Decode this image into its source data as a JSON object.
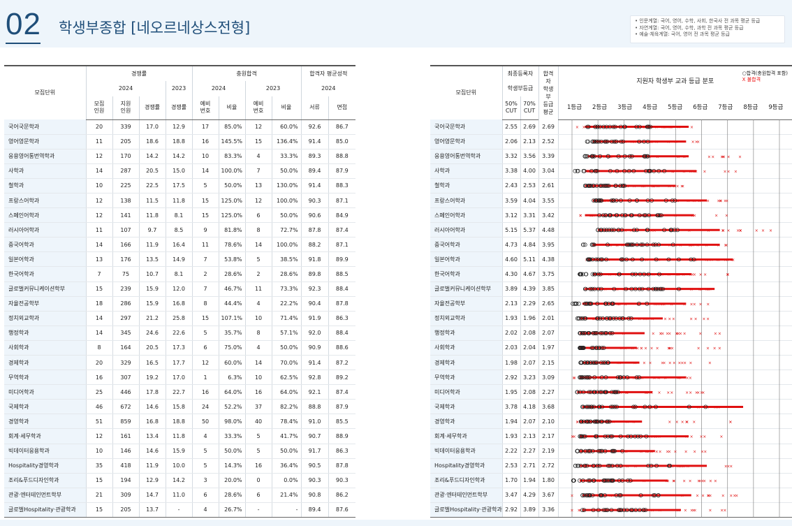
{
  "header": {
    "section_number": "02",
    "section_title": "학생부종합 [네오르네상스전형]",
    "notes": [
      "• 인문계열: 국어, 영어, 수학, 사회, 한국사 전 과목 평균 등급",
      "• 자연계열: 국어, 영어, 수학, 과학 전 과목 평균 등급",
      "• 예술·체육계열: 국어, 영어 전 과목 평균 등급"
    ]
  },
  "left_table": {
    "headers": {
      "unit": "모집단위",
      "competition": "경쟁률",
      "additional": "충원합격",
      "avg_score": "합격자 평균성적",
      "year_2024": "2024",
      "year_2023": "2023",
      "recruit": "모집\n인원",
      "applicants": "지원\n인원",
      "comp_rate": "경쟁률",
      "comp_rate_2023": "경쟁률",
      "waitlist_2024": "예비\n번호",
      "ratio_2024": "비율",
      "waitlist_2023": "예비\n번호",
      "ratio_2023": "비율",
      "documents": "서류",
      "interview": "면접"
    },
    "rows": [
      {
        "name": "국어국문학과",
        "recruit": "20",
        "applicants": "339",
        "comp": "17.0",
        "comp23": "12.9",
        "wait24": "17",
        "ratio24": "85.0%",
        "wait23": "12",
        "ratio23": "60.0%",
        "doc": "92.6",
        "intv": "86.7"
      },
      {
        "name": "영어영문학과",
        "recruit": "11",
        "applicants": "205",
        "comp": "18.6",
        "comp23": "18.8",
        "wait24": "16",
        "ratio24": "145.5%",
        "wait23": "15",
        "ratio23": "136.4%",
        "doc": "91.4",
        "intv": "85.0"
      },
      {
        "name": "응용영어통번역학과",
        "recruit": "12",
        "applicants": "170",
        "comp": "14.2",
        "comp23": "14.2",
        "wait24": "10",
        "ratio24": "83.3%",
        "wait23": "4",
        "ratio23": "33.3%",
        "doc": "89.3",
        "intv": "88.8"
      },
      {
        "name": "사학과",
        "recruit": "14",
        "applicants": "287",
        "comp": "20.5",
        "comp23": "15.0",
        "wait24": "14",
        "ratio24": "100.0%",
        "wait23": "7",
        "ratio23": "50.0%",
        "doc": "89.4",
        "intv": "87.9"
      },
      {
        "name": "철학과",
        "recruit": "10",
        "applicants": "225",
        "comp": "22.5",
        "comp23": "17.5",
        "wait24": "5",
        "ratio24": "50.0%",
        "wait23": "13",
        "ratio23": "130.0%",
        "doc": "91.4",
        "intv": "88.3"
      },
      {
        "name": "프랑스어학과",
        "recruit": "12",
        "applicants": "138",
        "comp": "11.5",
        "comp23": "11.8",
        "wait24": "15",
        "ratio24": "125.0%",
        "wait23": "12",
        "ratio23": "100.0%",
        "doc": "90.3",
        "intv": "87.1"
      },
      {
        "name": "스페인어학과",
        "recruit": "12",
        "applicants": "141",
        "comp": "11.8",
        "comp23": "8.1",
        "wait24": "15",
        "ratio24": "125.0%",
        "wait23": "6",
        "ratio23": "50.0%",
        "doc": "90.6",
        "intv": "84.9"
      },
      {
        "name": "러시아어학과",
        "recruit": "11",
        "applicants": "107",
        "comp": "9.7",
        "comp23": "8.5",
        "wait24": "9",
        "ratio24": "81.8%",
        "wait23": "8",
        "ratio23": "72.7%",
        "doc": "87.8",
        "intv": "87.4"
      },
      {
        "name": "중국어학과",
        "recruit": "14",
        "applicants": "166",
        "comp": "11.9",
        "comp23": "16.4",
        "wait24": "11",
        "ratio24": "78.6%",
        "wait23": "14",
        "ratio23": "100.0%",
        "doc": "88.2",
        "intv": "87.1"
      },
      {
        "name": "일본어학과",
        "recruit": "13",
        "applicants": "176",
        "comp": "13.5",
        "comp23": "14.9",
        "wait24": "7",
        "ratio24": "53.8%",
        "wait23": "5",
        "ratio23": "38.5%",
        "doc": "91.8",
        "intv": "89.9"
      },
      {
        "name": "한국어학과",
        "recruit": "7",
        "applicants": "75",
        "comp": "10.7",
        "comp23": "8.1",
        "wait24": "2",
        "ratio24": "28.6%",
        "wait23": "2",
        "ratio23": "28.6%",
        "doc": "89.8",
        "intv": "88.5"
      },
      {
        "name": "글로벌커뮤니케이션학부",
        "recruit": "15",
        "applicants": "239",
        "comp": "15.9",
        "comp23": "12.0",
        "wait24": "7",
        "ratio24": "46.7%",
        "wait23": "11",
        "ratio23": "73.3%",
        "doc": "92.3",
        "intv": "88.4"
      },
      {
        "name": "자율전공학부",
        "recruit": "18",
        "applicants": "286",
        "comp": "15.9",
        "comp23": "16.8",
        "wait24": "8",
        "ratio24": "44.4%",
        "wait23": "4",
        "ratio23": "22.2%",
        "doc": "90.4",
        "intv": "87.8"
      },
      {
        "name": "정치외교학과",
        "recruit": "14",
        "applicants": "297",
        "comp": "21.2",
        "comp23": "25.8",
        "wait24": "15",
        "ratio24": "107.1%",
        "wait23": "10",
        "ratio23": "71.4%",
        "doc": "91.9",
        "intv": "86.3"
      },
      {
        "name": "행정학과",
        "recruit": "14",
        "applicants": "345",
        "comp": "24.6",
        "comp23": "22.6",
        "wait24": "5",
        "ratio24": "35.7%",
        "wait23": "8",
        "ratio23": "57.1%",
        "doc": "92.0",
        "intv": "88.4"
      },
      {
        "name": "사회학과",
        "recruit": "8",
        "applicants": "164",
        "comp": "20.5",
        "comp23": "17.3",
        "wait24": "6",
        "ratio24": "75.0%",
        "wait23": "4",
        "ratio23": "50.0%",
        "doc": "90.9",
        "intv": "88.6"
      },
      {
        "name": "경제학과",
        "recruit": "20",
        "applicants": "329",
        "comp": "16.5",
        "comp23": "17.7",
        "wait24": "12",
        "ratio24": "60.0%",
        "wait23": "14",
        "ratio23": "70.0%",
        "doc": "91.4",
        "intv": "87.2"
      },
      {
        "name": "무역학과",
        "recruit": "16",
        "applicants": "307",
        "comp": "19.2",
        "comp23": "17.0",
        "wait24": "1",
        "ratio24": "6.3%",
        "wait23": "10",
        "ratio23": "62.5%",
        "doc": "92.8",
        "intv": "89.2"
      },
      {
        "name": "미디어학과",
        "recruit": "25",
        "applicants": "446",
        "comp": "17.8",
        "comp23": "22.7",
        "wait24": "16",
        "ratio24": "64.0%",
        "wait23": "16",
        "ratio23": "64.0%",
        "doc": "92.1",
        "intv": "87.4"
      },
      {
        "name": "국제학과",
        "recruit": "46",
        "applicants": "672",
        "comp": "14.6",
        "comp23": "15.8",
        "wait24": "24",
        "ratio24": "52.2%",
        "wait23": "37",
        "ratio23": "82.2%",
        "doc": "88.8",
        "intv": "87.9"
      },
      {
        "name": "경영학과",
        "recruit": "51",
        "applicants": "859",
        "comp": "16.8",
        "comp23": "18.8",
        "wait24": "50",
        "ratio24": "98.0%",
        "wait23": "40",
        "ratio23": "78.4%",
        "doc": "91.0",
        "intv": "85.5"
      },
      {
        "name": "회계·세무학과",
        "recruit": "12",
        "applicants": "161",
        "comp": "13.4",
        "comp23": "11.8",
        "wait24": "4",
        "ratio24": "33.3%",
        "wait23": "5",
        "ratio23": "41.7%",
        "doc": "90.7",
        "intv": "88.9"
      },
      {
        "name": "빅데이터응용학과",
        "recruit": "10",
        "applicants": "146",
        "comp": "14.6",
        "comp23": "15.9",
        "wait24": "5",
        "ratio24": "50.0%",
        "wait23": "5",
        "ratio23": "50.0%",
        "doc": "91.7",
        "intv": "86.3"
      },
      {
        "name": "Hospitality경영학과",
        "recruit": "35",
        "applicants": "418",
        "comp": "11.9",
        "comp23": "10.0",
        "wait24": "5",
        "ratio24": "14.3%",
        "wait23": "16",
        "ratio23": "36.4%",
        "doc": "90.5",
        "intv": "87.8"
      },
      {
        "name": "조리&푸드디자인학과",
        "recruit": "15",
        "applicants": "194",
        "comp": "12.9",
        "comp23": "14.2",
        "wait24": "3",
        "ratio24": "20.0%",
        "wait23": "0",
        "ratio23": "0.0%",
        "doc": "90.3",
        "intv": "90.3"
      },
      {
        "name": "관광·엔터테인먼트학부",
        "recruit": "21",
        "applicants": "309",
        "comp": "14.7",
        "comp23": "11.0",
        "wait24": "6",
        "ratio24": "28.6%",
        "wait23": "6",
        "ratio23": "21.4%",
        "doc": "90.8",
        "intv": "86.2"
      },
      {
        "name": "글로벌Hospitality·관광학과",
        "recruit": "15",
        "applicants": "205",
        "comp": "13.7",
        "comp23": "-",
        "wait24": "4",
        "ratio24": "26.7%",
        "wait23": "-",
        "ratio23": "-",
        "doc": "89.4",
        "intv": "87.6"
      }
    ]
  },
  "right_table": {
    "headers": {
      "unit": "모집단위",
      "final": "최종등록자",
      "gpa": "학생부등급",
      "cut50": "50%\nCUT",
      "cut70": "70%\nCUT",
      "passer_avg": "합격자\n학생부\n등급\n평균",
      "dist_title": "지원자 학생부 교과 등급 분포",
      "legend_pass": "○합격(충원합격 포함)",
      "legend_fail": "X 불합격",
      "grades": [
        "1등급",
        "2등급",
        "3등급",
        "4등급",
        "5등급",
        "6등급",
        "7등급",
        "8등급",
        "9등급"
      ]
    },
    "rows": [
      {
        "name": "국어국문학과",
        "c50": "2.55",
        "c70": "2.69",
        "avg": "2.69"
      },
      {
        "name": "영어영문학과",
        "c50": "2.06",
        "c70": "2.13",
        "avg": "2.52"
      },
      {
        "name": "응용영어통번역학과",
        "c50": "3.32",
        "c70": "3.56",
        "avg": "3.39"
      },
      {
        "name": "사학과",
        "c50": "3.38",
        "c70": "4.00",
        "avg": "3.04"
      },
      {
        "name": "철학과",
        "c50": "2.43",
        "c70": "2.53",
        "avg": "2.61"
      },
      {
        "name": "프랑스어학과",
        "c50": "3.59",
        "c70": "4.04",
        "avg": "3.55"
      },
      {
        "name": "스페인어학과",
        "c50": "3.12",
        "c70": "3.31",
        "avg": "3.42"
      },
      {
        "name": "러시아어학과",
        "c50": "5.15",
        "c70": "5.37",
        "avg": "4.48"
      },
      {
        "name": "중국어학과",
        "c50": "4.73",
        "c70": "4.84",
        "avg": "3.95"
      },
      {
        "name": "일본어학과",
        "c50": "4.60",
        "c70": "5.11",
        "avg": "4.38"
      },
      {
        "name": "한국어학과",
        "c50": "4.30",
        "c70": "4.67",
        "avg": "3.75"
      },
      {
        "name": "글로벌커뮤니케이션학부",
        "c50": "3.89",
        "c70": "4.39",
        "avg": "3.85"
      },
      {
        "name": "자율전공학부",
        "c50": "2.13",
        "c70": "2.29",
        "avg": "2.65"
      },
      {
        "name": "정치외교학과",
        "c50": "1.93",
        "c70": "1.96",
        "avg": "2.01"
      },
      {
        "name": "행정학과",
        "c50": "2.02",
        "c70": "2.08",
        "avg": "2.07"
      },
      {
        "name": "사회학과",
        "c50": "2.03",
        "c70": "2.04",
        "avg": "1.97"
      },
      {
        "name": "경제학과",
        "c50": "1.98",
        "c70": "2.07",
        "avg": "2.15"
      },
      {
        "name": "무역학과",
        "c50": "2.92",
        "c70": "3.23",
        "avg": "3.09"
      },
      {
        "name": "미디어학과",
        "c50": "1.95",
        "c70": "2.08",
        "avg": "2.27"
      },
      {
        "name": "국제학과",
        "c50": "3.78",
        "c70": "4.18",
        "avg": "3.68"
      },
      {
        "name": "경영학과",
        "c50": "1.94",
        "c70": "2.07",
        "avg": "2.10"
      },
      {
        "name": "회계·세무학과",
        "c50": "1.93",
        "c70": "2.13",
        "avg": "2.17"
      },
      {
        "name": "빅데이터응용학과",
        "c50": "2.22",
        "c70": "2.27",
        "avg": "2.19"
      },
      {
        "name": "Hospitality경영학과",
        "c50": "2.53",
        "c70": "2.71",
        "avg": "2.72"
      },
      {
        "name": "조리&푸드디자인학과",
        "c50": "1.70",
        "c70": "1.94",
        "avg": "1.80"
      },
      {
        "name": "관광·엔터테인먼트학부",
        "c50": "3.47",
        "c70": "4.29",
        "avg": "3.67"
      },
      {
        "name": "글로벌Hospitality·관광학과",
        "c50": "2.92",
        "c70": "3.89",
        "avg": "3.36"
      }
    ]
  },
  "chart_data": {
    "type": "scatter",
    "title": "지원자 학생부 교과 등급 분포",
    "x_range": [
      1,
      9
    ],
    "legend": [
      "○합격(충원합격 포함)",
      "X 불합격"
    ],
    "colors": {
      "pass": "#222222",
      "fail": "#e01010"
    },
    "series": [
      {
        "name": "국어국문학과",
        "pass_range": [
          1.5,
          4.3
        ],
        "fail_range": [
          1.2,
          6.0
        ]
      },
      {
        "name": "영어영문학과",
        "pass_range": [
          1.3,
          4.2
        ],
        "fail_range": [
          1.8,
          6.2
        ]
      },
      {
        "name": "응용영어통번역학과",
        "pass_range": [
          1.5,
          4.3
        ],
        "fail_range": [
          1.6,
          7.5
        ]
      },
      {
        "name": "사학과",
        "pass_range": [
          1.1,
          4.6
        ],
        "fail_range": [
          1.5,
          7.5
        ]
      },
      {
        "name": "철학과",
        "pass_range": [
          1.5,
          3.8
        ],
        "fail_range": [
          1.0,
          5.3
        ]
      },
      {
        "name": "프랑스어학과",
        "pass_range": [
          1.8,
          5.0
        ],
        "fail_range": [
          1.8,
          7.2
        ]
      },
      {
        "name": "스페인어학과",
        "pass_range": [
          1.5,
          4.5
        ],
        "fail_range": [
          1.3,
          7.0
        ]
      },
      {
        "name": "러시아어학과",
        "pass_range": [
          2.0,
          5.5
        ],
        "fail_range": [
          1.5,
          9.0
        ]
      },
      {
        "name": "중국어학과",
        "pass_range": [
          1.4,
          5.5
        ],
        "fail_range": [
          1.8,
          7.2
        ]
      },
      {
        "name": "일본어학과",
        "pass_range": [
          1.6,
          6.0
        ],
        "fail_range": [
          1.2,
          7.5
        ]
      },
      {
        "name": "한국어학과",
        "pass_range": [
          1.3,
          4.4
        ],
        "fail_range": [
          1.8,
          7.2
        ]
      },
      {
        "name": "글로벌커뮤니케이션학부",
        "pass_range": [
          1.5,
          5.3
        ],
        "fail_range": [
          1.3,
          7.0
        ]
      },
      {
        "name": "자율전공학부",
        "pass_range": [
          1.0,
          4.2
        ],
        "fail_range": [
          1.4,
          7.0
        ]
      },
      {
        "name": "정치외교학과",
        "pass_range": [
          1.2,
          3.3
        ],
        "fail_range": [
          1.3,
          7.0
        ]
      },
      {
        "name": "행정학과",
        "pass_range": [
          1.3,
          2.6
        ],
        "fail_range": [
          1.3,
          6.8
        ]
      },
      {
        "name": "사회학과",
        "pass_range": [
          1.3,
          2.3
        ],
        "fail_range": [
          1.3,
          6.8
        ]
      },
      {
        "name": "경제학과",
        "pass_range": [
          1.3,
          2.4
        ],
        "fail_range": [
          1.4,
          6.4
        ]
      },
      {
        "name": "무역학과",
        "pass_range": [
          1.3,
          4.2
        ],
        "fail_range": [
          1.0,
          6.0
        ]
      },
      {
        "name": "미디어학과",
        "pass_range": [
          1.2,
          2.9
        ],
        "fail_range": [
          1.0,
          6.2
        ]
      },
      {
        "name": "국제학과",
        "pass_range": [
          1.4,
          6.4
        ],
        "fail_range": [
          1.4,
          7.8
        ]
      },
      {
        "name": "경영학과",
        "pass_range": [
          1.3,
          2.5
        ],
        "fail_range": [
          1.0,
          7.5
        ]
      },
      {
        "name": "회계·세무학과",
        "pass_range": [
          1.3,
          4.3
        ],
        "fail_range": [
          1.0,
          7.0
        ]
      },
      {
        "name": "빅데이터응용학과",
        "pass_range": [
          1.2,
          3.0
        ],
        "fail_range": [
          1.3,
          6.3
        ]
      },
      {
        "name": "Hospitality경영학과",
        "pass_range": [
          1.1,
          5.0
        ],
        "fail_range": [
          1.3,
          7.6
        ]
      },
      {
        "name": "조리&푸드디자인학과",
        "pass_range": [
          1.0,
          3.5
        ],
        "fail_range": [
          1.3,
          6.8
        ]
      },
      {
        "name": "관광·엔터테인먼트학부",
        "pass_range": [
          1.4,
          4.4
        ],
        "fail_range": [
          1.0,
          8.2
        ]
      },
      {
        "name": "글로벌Hospitality·관광학과",
        "pass_range": [
          1.4,
          4.0
        ],
        "fail_range": [
          1.0,
          7.5
        ]
      }
    ]
  }
}
